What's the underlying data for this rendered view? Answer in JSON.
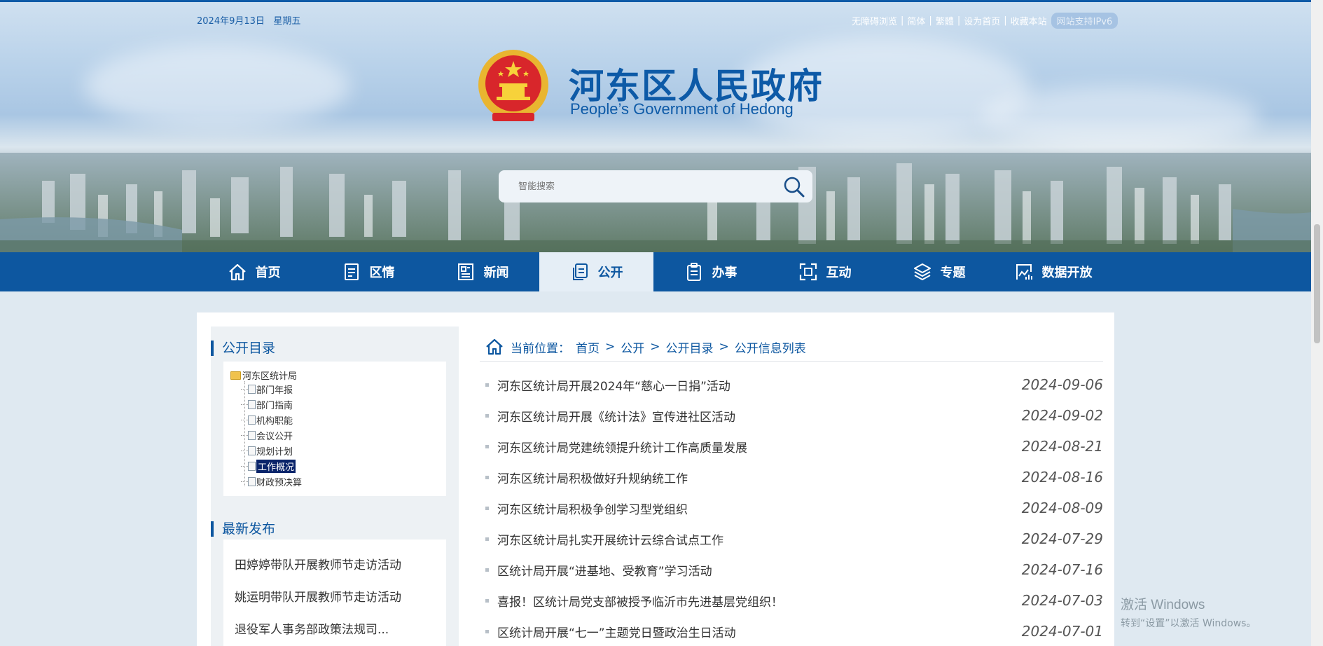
{
  "header": {
    "date": "2024年9月13日",
    "weekday": "星期五",
    "top_links": [
      "无障碍浏览",
      "简体",
      "繁體",
      "设为首页",
      "收藏本站"
    ],
    "ipv6_badge": "网站支持IPv6",
    "title": "河东区人民政府",
    "subtitle": "People’s Government of Hedong",
    "search_placeholder": "智能搜索"
  },
  "nav": {
    "items": [
      {
        "label": "首页",
        "icon": "home-icon"
      },
      {
        "label": "区情",
        "icon": "document-icon"
      },
      {
        "label": "新闻",
        "icon": "news-icon"
      },
      {
        "label": "公开",
        "icon": "copy-icon",
        "active": true
      },
      {
        "label": "办事",
        "icon": "clipboard-icon"
      },
      {
        "label": "互动",
        "icon": "interact-icon"
      },
      {
        "label": "专题",
        "icon": "layers-icon"
      },
      {
        "label": "数据开放",
        "icon": "data-icon"
      }
    ]
  },
  "sidebar": {
    "catalog_title": "公开目录",
    "tree_root": "河东区统计局",
    "tree_items": [
      "部门年报",
      "部门指南",
      "机构职能",
      "会议公开",
      "规划计划",
      "工作概况",
      "财政预决算"
    ],
    "selected_item": "工作概况",
    "latest_title": "最新发布",
    "latest_items": [
      "田婷婷带队开展教师节走访活动",
      "姚运明带队开展教师节走访活动",
      "退役军人事务部政策法规司..."
    ]
  },
  "breadcrumb": {
    "label": "当前位置：",
    "items": [
      "首页",
      "公开",
      "公开目录",
      "公开信息列表"
    ],
    "separator": ">"
  },
  "list": [
    {
      "title": "河东区统计局开展2024年“慈心一日捐”活动",
      "date": "2024-09-06"
    },
    {
      "title": "河东区统计局开展《统计法》宣传进社区活动",
      "date": "2024-09-02"
    },
    {
      "title": "河东区统计局党建统领提升统计工作高质量发展",
      "date": "2024-08-21"
    },
    {
      "title": "河东区统计局积极做好升规纳统工作",
      "date": "2024-08-16"
    },
    {
      "title": "河东区统计局积极争创学习型党组织",
      "date": "2024-08-09"
    },
    {
      "title": "河东区统计局扎实开展统计云综合试点工作",
      "date": "2024-07-29"
    },
    {
      "title": "区统计局开展“进基地、受教育”学习活动",
      "date": "2024-07-16"
    },
    {
      "title": "喜报！区统计局党支部被授予临沂市先进基层党组织！",
      "date": "2024-07-03"
    },
    {
      "title": "区统计局开展“七一”主题党日暨政治生日活动",
      "date": "2024-07-01"
    }
  ],
  "watermark": {
    "line1": "激活 Windows",
    "line2": "转到“设置”以激活 Windows。"
  },
  "colors": {
    "primary": "#0d57a0",
    "nav_active_bg": "#e5eef6",
    "page_bg": "#dfe9f1"
  }
}
